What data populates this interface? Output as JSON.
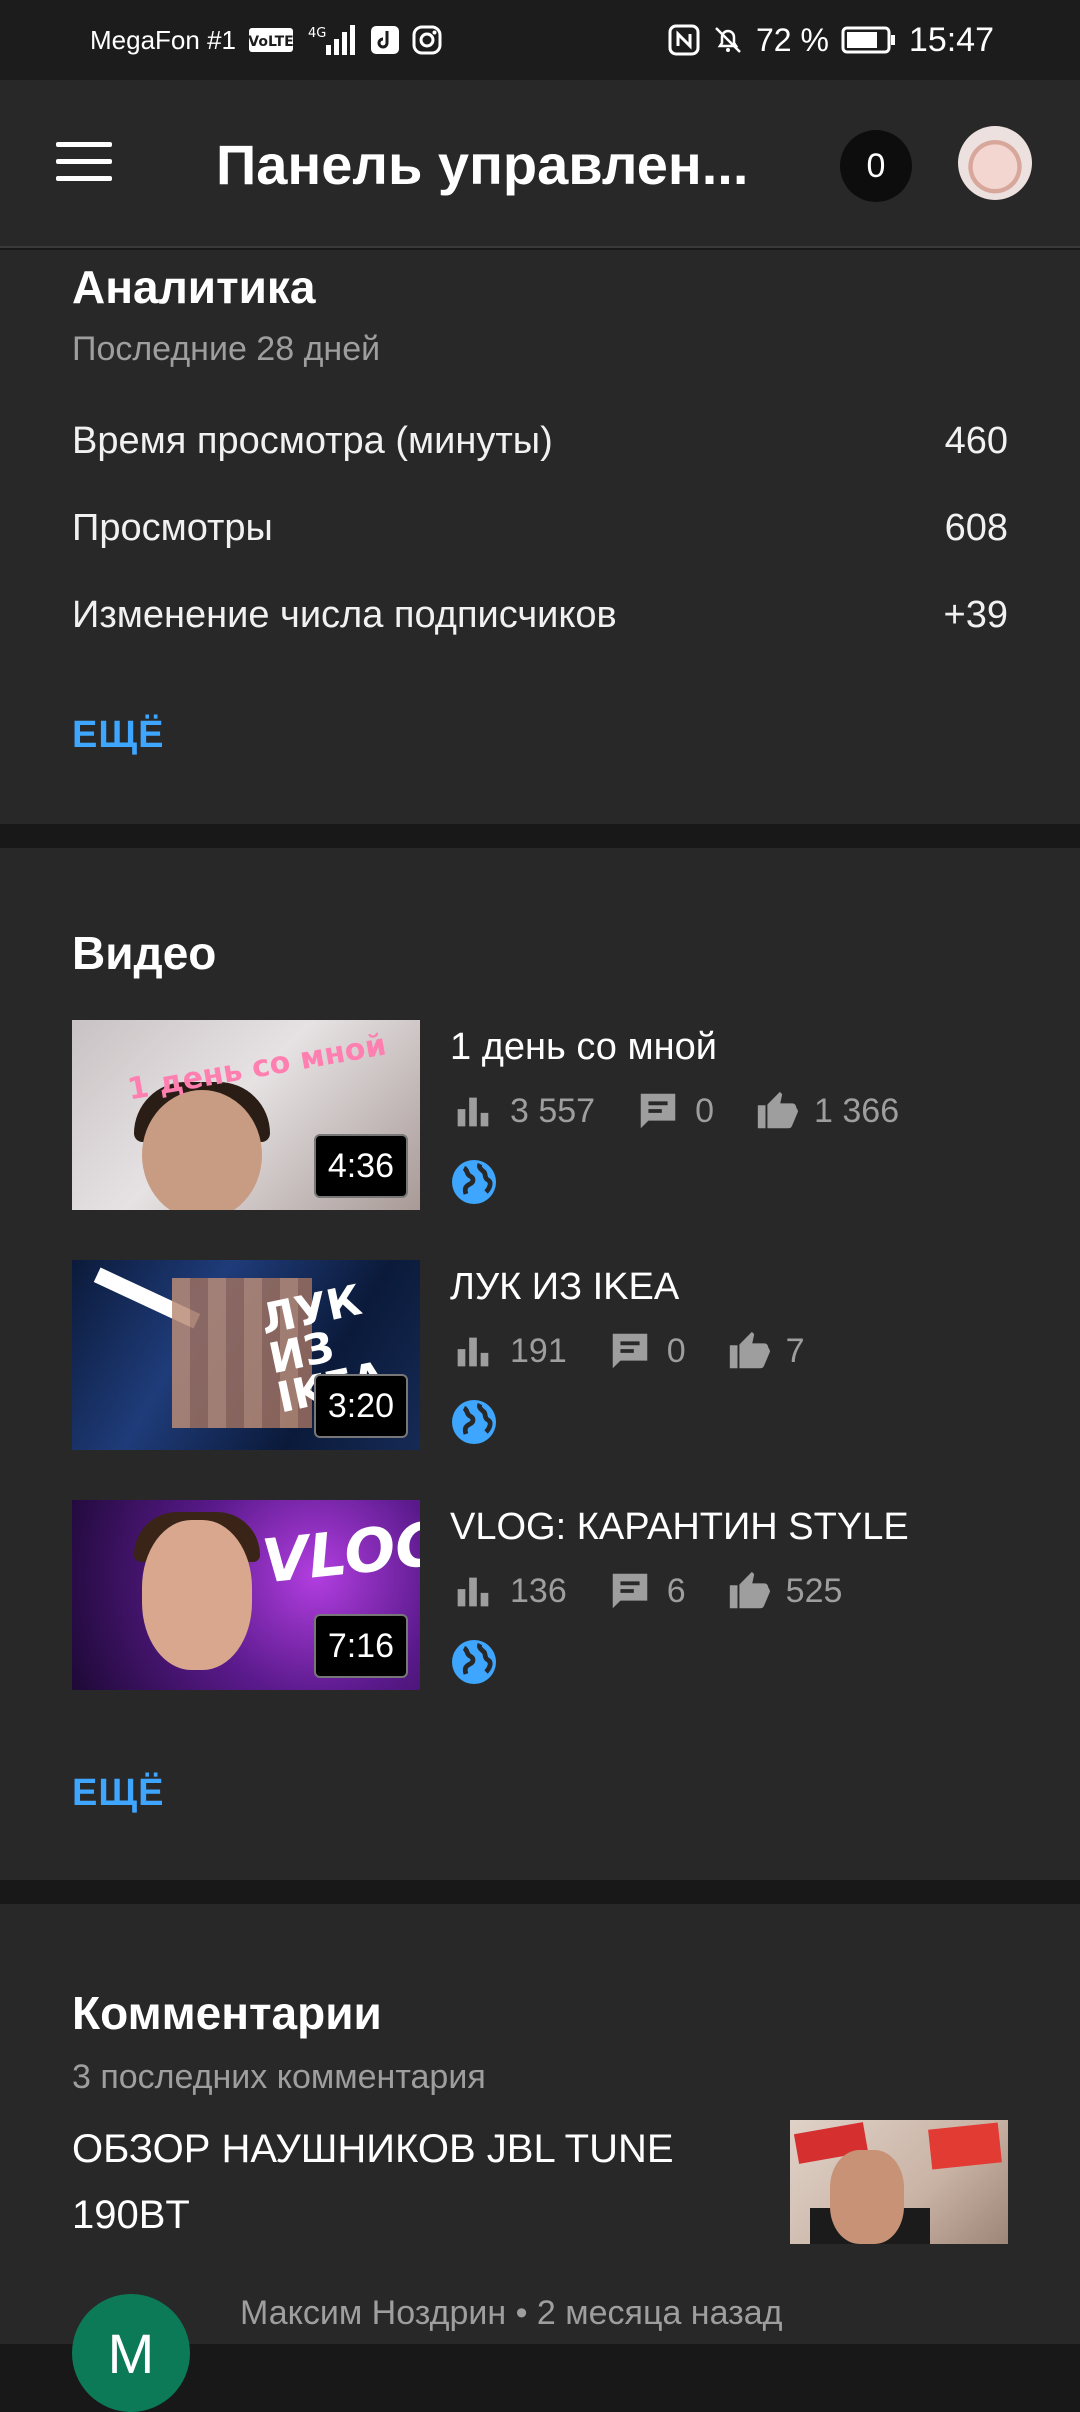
{
  "status_bar": {
    "carrier": "MegaFon #1",
    "volte": "VoLTE",
    "network": "4G",
    "battery_percent": "72 %",
    "time": "15:47"
  },
  "app_bar": {
    "title": "Панель управлен...",
    "notification_count": "0"
  },
  "analytics": {
    "title": "Аналитика",
    "subtitle": "Последние 28 дней",
    "rows": [
      {
        "label": "Время просмотра (минуты)",
        "value": "460"
      },
      {
        "label": "Просмотры",
        "value": "608"
      },
      {
        "label": "Изменение числа подписчиков",
        "value": "+39"
      }
    ],
    "more_label": "ЕЩЁ"
  },
  "videos": {
    "title": "Видео",
    "items": [
      {
        "title": "1 день со мной",
        "duration": "4:36",
        "views": "3 557",
        "comments": "0",
        "likes": "1 366",
        "thumb_text": "1 день со мной"
      },
      {
        "title": "ЛУК ИЗ IKEA",
        "duration": "3:20",
        "views": "191",
        "comments": "0",
        "likes": "7",
        "thumb_text": "ЛУК ИЗ IKEA"
      },
      {
        "title": "VLOG: КАРАНТИН STYLE",
        "duration": "7:16",
        "views": "136",
        "comments": "6",
        "likes": "525",
        "thumb_text": "VLOG"
      }
    ],
    "more_label": "ЕЩЁ"
  },
  "comments": {
    "title": "Комментарии",
    "subtitle": "3 последних комментария",
    "video_title": "ОБЗОР НАУШНИКОВ JBL TUNE 190BT",
    "author_initial": "М",
    "author_meta": "Максим Ноздрин • 2 месяца назад"
  },
  "colors": {
    "accent": "#3ea6ff",
    "background": "#282828",
    "separator": "#181818",
    "secondary_text": "#9e9e9e"
  }
}
